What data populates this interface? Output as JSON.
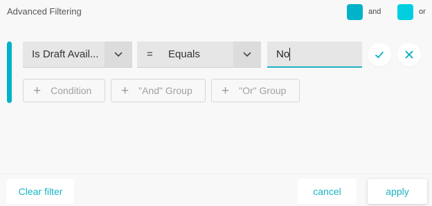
{
  "header": {
    "title": "Advanced Filtering",
    "legend": [
      {
        "label": "and",
        "color": "#00b3c8"
      },
      {
        "label": "or",
        "color": "#00cfe0"
      }
    ]
  },
  "condition": {
    "field": "Is Draft Avail...",
    "operator_symbol": "=",
    "operator": "Equals",
    "value": "No",
    "group_color": "#00b3c8",
    "accent_color": "#1ab3c4"
  },
  "add_buttons": {
    "condition": "Condition",
    "and_group": "\"And\" Group",
    "or_group": "\"Or\" Group"
  },
  "footer": {
    "clear": "Clear filter",
    "cancel": "cancel",
    "apply": "apply"
  },
  "icons": [
    "chevron-down-icon",
    "check-icon",
    "close-icon",
    "plus-icon"
  ]
}
